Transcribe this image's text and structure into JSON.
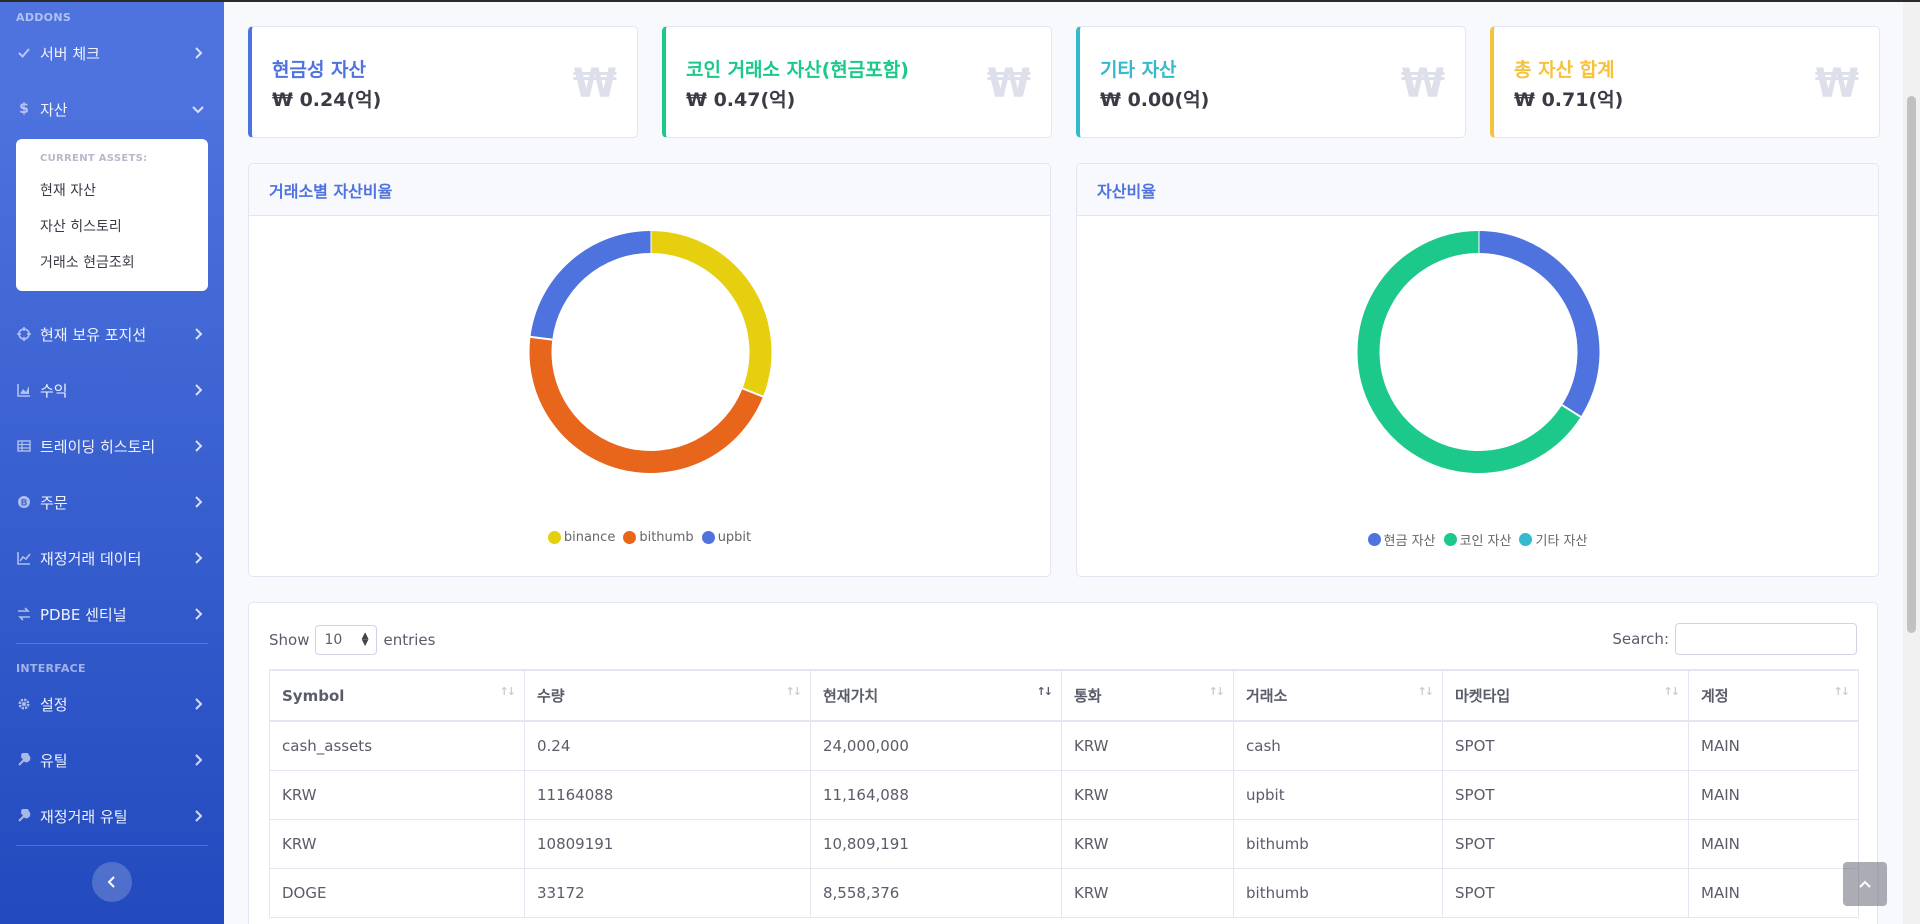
{
  "colors": {
    "primary": "#4e73df",
    "success": "#1cc88a",
    "info": "#36b9cc",
    "warning": "#f6c23e",
    "binance": "#e6cf0f",
    "bithumb": "#e8661c",
    "upbit": "#4e73df"
  },
  "sidebar": {
    "addons_heading": "ADDONS",
    "interface_heading": "INTERFACE",
    "items": [
      {
        "label": "서버 체크",
        "icon": "check-icon"
      },
      {
        "label": "자산",
        "icon": "dollar-icon"
      },
      {
        "label": "현재 보유 포지션",
        "icon": "crosshair-icon"
      },
      {
        "label": "수익",
        "icon": "area-chart-icon"
      },
      {
        "label": "트레이딩 히스토리",
        "icon": "table-icon"
      },
      {
        "label": "주문",
        "icon": "bitcoin-icon"
      },
      {
        "label": "재정거래 데이터",
        "icon": "line-chart-icon"
      },
      {
        "label": "PDBE 센티널",
        "icon": "exchange-icon"
      },
      {
        "label": "설정",
        "icon": "gear-icon"
      },
      {
        "label": "유틸",
        "icon": "wrench-icon"
      },
      {
        "label": "재정거래 유틸",
        "icon": "wrench-icon"
      }
    ],
    "submenu": {
      "heading": "CURRENT ASSETS:",
      "items": [
        "현재 자산",
        "자산 히스토리",
        "거래소 현금조회"
      ]
    }
  },
  "stats": [
    {
      "label": "현금성 자산",
      "value": "₩ 0.24(억)",
      "icon": "₩"
    },
    {
      "label": "코인 거래소 자산(현금포함)",
      "value": "₩ 0.47(억)",
      "icon": "₩"
    },
    {
      "label": "기타 자산",
      "value": "₩ 0.00(억)",
      "icon": "₩"
    },
    {
      "label": "총 자산 합계",
      "value": "₩ 0.71(억)",
      "icon": "₩"
    }
  ],
  "charts": {
    "exchange_title": "거래소별 자산비율",
    "ratio_title": "자산비율"
  },
  "chart_data": [
    {
      "type": "pie",
      "title": "거래소별 자산비율",
      "donut": true,
      "legend": "bottom",
      "categories": [
        "binance",
        "bithumb",
        "upbit"
      ],
      "values": [
        31,
        46,
        23
      ]
    },
    {
      "type": "pie",
      "title": "자산비율",
      "donut": true,
      "legend": "bottom",
      "categories": [
        "현금 자산",
        "코인 자산",
        "기타 자산"
      ],
      "values": [
        34,
        66,
        0
      ]
    }
  ],
  "table": {
    "show_label": "Show",
    "entries_value": "10",
    "entries_label": "entries",
    "search_label": "Search:",
    "headers": [
      "Symbol",
      "수량",
      "현재가치",
      "통화",
      "거래소",
      "마켓타입",
      "계정"
    ],
    "rows": [
      [
        "cash_assets",
        "0.24",
        "24,000,000",
        "KRW",
        "cash",
        "SPOT",
        "MAIN"
      ],
      [
        "KRW",
        "11164088",
        "11,164,088",
        "KRW",
        "upbit",
        "SPOT",
        "MAIN"
      ],
      [
        "KRW",
        "10809191",
        "10,809,191",
        "KRW",
        "bithumb",
        "SPOT",
        "MAIN"
      ],
      [
        "DOGE",
        "33172",
        "8,558,376",
        "KRW",
        "bithumb",
        "SPOT",
        "MAIN"
      ]
    ]
  }
}
